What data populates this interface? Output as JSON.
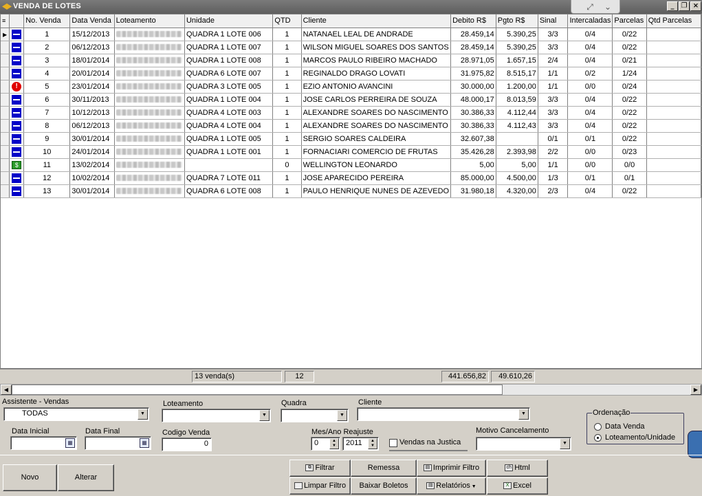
{
  "window": {
    "title": "VENDA DE LOTES"
  },
  "grid": {
    "columns": [
      "No. Venda",
      "Data Venda",
      "Loteamento",
      "Unidade",
      "QTD",
      "Cliente",
      "Debito R$",
      "Pgto R$",
      "Sinal",
      "Intercaladas",
      "Parcelas",
      "Qtd Parcelas"
    ],
    "rows": [
      {
        "icon": "blue-status-icon",
        "no": "1",
        "data": "15/12/2013",
        "unidade": "QUADRA 1 LOTE 006",
        "qtd": "1",
        "cliente": "NATANAEL LEAL DE ANDRADE",
        "debito": "28.459,14",
        "pgto": "5.390,25",
        "sinal": "3/3",
        "interc": "0/4",
        "parcelas": "0/22"
      },
      {
        "icon": "blue-status-icon",
        "no": "2",
        "data": "06/12/2013",
        "unidade": "QUADRA 1 LOTE 007",
        "qtd": "1",
        "cliente": "WILSON MIGUEL SOARES DOS SANTOS",
        "debito": "28.459,14",
        "pgto": "5.390,25",
        "sinal": "3/3",
        "interc": "0/4",
        "parcelas": "0/22"
      },
      {
        "icon": "blue-status-icon",
        "no": "3",
        "data": "18/01/2014",
        "unidade": "QUADRA 1 LOTE 008",
        "qtd": "1",
        "cliente": "MARCOS PAULO RIBEIRO MACHADO",
        "debito": "28.971,05",
        "pgto": "1.657,15",
        "sinal": "2/4",
        "interc": "0/4",
        "parcelas": "0/21"
      },
      {
        "icon": "blue-status-icon",
        "no": "4",
        "data": "20/01/2014",
        "unidade": "QUADRA 6 LOTE 007",
        "qtd": "1",
        "cliente": "REGINALDO DRAGO LOVATI",
        "debito": "31.975,82",
        "pgto": "8.515,17",
        "sinal": "1/1",
        "interc": "0/2",
        "parcelas": "1/24"
      },
      {
        "icon": "red-alert-icon",
        "no": "5",
        "data": "23/01/2014",
        "unidade": "QUADRA 3 LOTE 005",
        "qtd": "1",
        "cliente": "EZIO ANTONIO AVANCINI",
        "debito": "30.000,00",
        "pgto": "1.200,00",
        "sinal": "1/1",
        "interc": "0/0",
        "parcelas": "0/24"
      },
      {
        "icon": "blue-status-icon",
        "no": "6",
        "data": "30/11/2013",
        "unidade": "QUADRA 1 LOTE 004",
        "qtd": "1",
        "cliente": "JOSE CARLOS PERREIRA DE SOUZA",
        "debito": "48.000,17",
        "pgto": "8.013,59",
        "sinal": "3/3",
        "interc": "0/4",
        "parcelas": "0/22"
      },
      {
        "icon": "blue-status-icon",
        "no": "7",
        "data": "10/12/2013",
        "unidade": "QUADRA 4 LOTE 003",
        "qtd": "1",
        "cliente": "ALEXANDRE SOARES DO NASCIMENTO",
        "debito": "30.386,33",
        "pgto": "4.112,44",
        "sinal": "3/3",
        "interc": "0/4",
        "parcelas": "0/22"
      },
      {
        "icon": "blue-status-icon",
        "no": "8",
        "data": "06/12/2013",
        "unidade": "QUADRA 4 LOTE 004",
        "qtd": "1",
        "cliente": "ALEXANDRE SOARES DO NASCIMENTO",
        "debito": "30.386,33",
        "pgto": "4.112,43",
        "sinal": "3/3",
        "interc": "0/4",
        "parcelas": "0/22"
      },
      {
        "icon": "blue-status-icon",
        "no": "9",
        "data": "30/01/2014",
        "unidade": "QUADRA 1 LOTE 005",
        "qtd": "1",
        "cliente": "SERGIO SOARES CALDEIRA",
        "debito": "32.607,38",
        "pgto": "",
        "sinal": "0/1",
        "interc": "0/1",
        "parcelas": "0/22"
      },
      {
        "icon": "blue-status-icon",
        "no": "10",
        "data": "24/01/2014",
        "unidade": "QUADRA 1 LOTE 001",
        "qtd": "1",
        "cliente": "FORNACIARI COMERCIO DE FRUTAS",
        "debito": "35.426,28",
        "pgto": "2.393,98",
        "sinal": "2/2",
        "interc": "0/0",
        "parcelas": "0/23"
      },
      {
        "icon": "money-icon",
        "no": "11",
        "data": "13/02/2014",
        "unidade": "",
        "qtd": "0",
        "cliente": "WELLINGTON LEONARDO",
        "debito": "5,00",
        "pgto": "5,00",
        "sinal": "1/1",
        "interc": "0/0",
        "parcelas": "0/0"
      },
      {
        "icon": "blue-status-icon",
        "no": "12",
        "data": "10/02/2014",
        "unidade": "QUADRA 7 LOTE 011",
        "qtd": "1",
        "cliente": "JOSE APARECIDO PEREIRA",
        "debito": "85.000,00",
        "pgto": "4.500,00",
        "sinal": "1/3",
        "interc": "0/1",
        "parcelas": "0/1"
      },
      {
        "icon": "blue-status-icon",
        "no": "13",
        "data": "30/01/2014",
        "unidade": "QUADRA 6 LOTE 008",
        "qtd": "1",
        "cliente": "PAULO HENRIQUE NUNES DE AZEVEDO",
        "debito": "31.980,18",
        "pgto": "4.320,00",
        "sinal": "2/3",
        "interc": "0/4",
        "parcelas": "0/22"
      }
    ]
  },
  "totals": {
    "count": "13 venda(s)",
    "qtd": "12",
    "debito": "441.656,82",
    "pgto": "49.610,26"
  },
  "filters": {
    "assistente_label": "Assistente - Vendas",
    "assistente_value": "TODAS",
    "loteamento_label": "Loteamento",
    "quadra_label": "Quadra",
    "cliente_label": "Cliente",
    "data_inicial_label": "Data Inicial",
    "data_final_label": "Data Final",
    "codigo_label": "Codigo Venda",
    "codigo_value": "0",
    "mesano_label": "Mes/Ano Reajuste",
    "mes_value": "0",
    "ano_value": "2011",
    "justica_label": "Vendas na Justica",
    "motivo_label": "Motivo Cancelamento",
    "ordenacao_label": "Ordenação",
    "ord_opt1": "Data Venda",
    "ord_opt2": "Loteamento/Unidade"
  },
  "buttons": {
    "novo": "Novo",
    "alterar": "Alterar",
    "filtrar": "Filtrar",
    "remessa": "Remessa",
    "imprimir": "Imprimir Filtro",
    "html": "Html",
    "limpar": "Limpar Filtro",
    "baixar": "Baixar Boletos",
    "relatorios": "Relatórios",
    "excel": "Excel"
  }
}
